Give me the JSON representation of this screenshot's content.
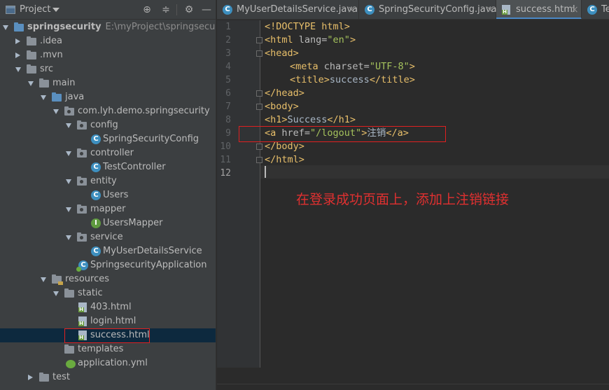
{
  "project_panel": {
    "title": "Project",
    "tree": [
      {
        "label": "springsecurity",
        "path": "E:\\myProject\\springsecurity",
        "icon": "module-folder-icon",
        "expanded": true
      },
      {
        "label": ".idea",
        "icon": "folder-icon",
        "expanded": false
      },
      {
        "label": ".mvn",
        "icon": "folder-icon",
        "expanded": false
      },
      {
        "label": "src",
        "icon": "folder-icon",
        "expanded": true
      },
      {
        "label": "main",
        "icon": "folder-icon",
        "expanded": true
      },
      {
        "label": "java",
        "icon": "source-folder-icon",
        "expanded": true
      },
      {
        "label": "com.lyh.demo.springsecurity",
        "icon": "package-icon",
        "expanded": true
      },
      {
        "label": "config",
        "icon": "package-icon",
        "expanded": true
      },
      {
        "label": "SpringSecurityConfig",
        "icon": "class-icon"
      },
      {
        "label": "controller",
        "icon": "package-icon",
        "expanded": true
      },
      {
        "label": "TestController",
        "icon": "class-icon"
      },
      {
        "label": "entity",
        "icon": "package-icon",
        "expanded": true
      },
      {
        "label": "Users",
        "icon": "class-icon"
      },
      {
        "label": "mapper",
        "icon": "package-icon",
        "expanded": true
      },
      {
        "label": "UsersMapper",
        "icon": "interface-icon"
      },
      {
        "label": "service",
        "icon": "package-icon",
        "expanded": true
      },
      {
        "label": "MyUserDetailsService",
        "icon": "class-icon"
      },
      {
        "label": "SpringsecurityApplication",
        "icon": "spring-boot-class-icon"
      },
      {
        "label": "resources",
        "icon": "resources-folder-icon",
        "expanded": true
      },
      {
        "label": "static",
        "icon": "folder-icon",
        "expanded": true
      },
      {
        "label": "403.html",
        "icon": "html-file-icon"
      },
      {
        "label": "login.html",
        "icon": "html-file-icon"
      },
      {
        "label": "success.html",
        "icon": "html-file-icon",
        "selected": true
      },
      {
        "label": "templates",
        "icon": "folder-icon"
      },
      {
        "label": "application.yml",
        "icon": "yml-file-icon"
      },
      {
        "label": "test",
        "icon": "folder-icon",
        "expanded": false
      }
    ]
  },
  "tabs": [
    {
      "label": "MyUserDetailsService.java",
      "icon": "class-icon",
      "active": false
    },
    {
      "label": "SpringSecurityConfig.java",
      "icon": "class-icon",
      "active": false
    },
    {
      "label": "success.html",
      "icon": "html-file-icon",
      "active": true
    },
    {
      "label": "Te",
      "icon": "class-icon",
      "active": false
    }
  ],
  "editor": {
    "line_numbers": [
      "1",
      "2",
      "3",
      "4",
      "5",
      "6",
      "7",
      "8",
      "9",
      "10",
      "11",
      "12"
    ],
    "current_line": "12",
    "lines": [
      {
        "t1": "<!DOCTYPE html>"
      },
      {
        "t1": "<html ",
        "a1": "lang=",
        "v1": "\"en\"",
        "t2": ">"
      },
      {
        "t1": "<head>"
      },
      {
        "t1": "<meta ",
        "a1": "charset=",
        "v1": "\"UTF-8\"",
        "t2": ">"
      },
      {
        "t1": "<title>",
        "x1": "success",
        "t2": "</title>"
      },
      {
        "t1": "</head>"
      },
      {
        "t1": "<body>"
      },
      {
        "t1": "<h1>",
        "x1": "Success",
        "t2": "</h1>"
      },
      {
        "t1": "<a ",
        "a1": "href=",
        "v1": "\"/logout\"",
        "t2": ">",
        "x1": "注销",
        "t3": "</a>"
      },
      {
        "t1": "</body>"
      },
      {
        "t1": "</html>"
      },
      {
        "t1": ""
      }
    ]
  },
  "annotation": "在登录成功页面上，添加上注销链接",
  "colors": {
    "annotation_red": "#e03030",
    "highlight_box": "#e02020",
    "tag": "#e8bf6a",
    "attr_value": "#a5c25c",
    "active_tab_underline": "#4a88c7"
  }
}
